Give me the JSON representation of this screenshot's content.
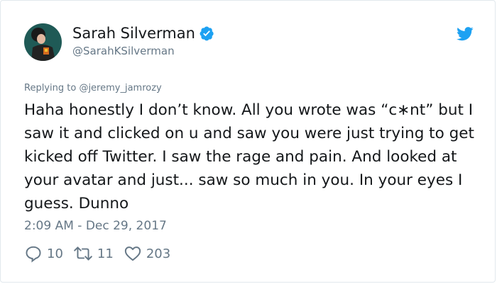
{
  "tweet": {
    "author_name": "Sarah Silverman",
    "author_handle": "@SarahKSilverman",
    "reply_prefix": "Replying to ",
    "reply_to": "@jeremy_jamrozy",
    "text": "Haha honestly I don’t know. All you wrote was “c∗nt” but I saw it and clicked on u and saw you were just trying to get kicked off Twitter. I saw the rage and pain. And looked at your avatar and just... saw so much in you. In your eyes I guess. Dunno",
    "timestamp": "2:09 AM - Dec 29, 2017"
  },
  "actions": {
    "replies": "10",
    "retweets": "11",
    "likes": "203"
  },
  "icons": {
    "verified": "verified-badge-icon",
    "platform": "twitter-bird-icon",
    "reply": "reply-icon",
    "retweet": "retweet-icon",
    "like": "heart-icon"
  },
  "colors": {
    "accent": "#1da1f2",
    "text": "#14171a",
    "secondary": "#657786",
    "border": "#e1e8ed"
  }
}
